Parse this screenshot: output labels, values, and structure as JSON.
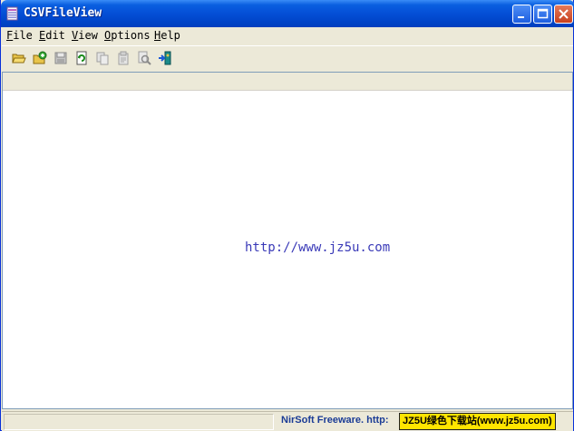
{
  "window": {
    "title": "CSVFileView"
  },
  "menu": {
    "items": [
      {
        "label": "File",
        "underline": "F"
      },
      {
        "label": "Edit",
        "underline": "E"
      },
      {
        "label": "View",
        "underline": "V"
      },
      {
        "label": "Options",
        "underline": "O"
      },
      {
        "label": "Help",
        "underline": "H"
      }
    ]
  },
  "toolbar": {
    "buttons": [
      {
        "icon": "open-folder-icon"
      },
      {
        "icon": "open-refresh-icon"
      },
      {
        "icon": "save-icon"
      },
      {
        "icon": "refresh-icon"
      },
      {
        "icon": "copy-icon"
      },
      {
        "icon": "properties-icon"
      },
      {
        "icon": "find-icon"
      },
      {
        "icon": "exit-icon"
      }
    ]
  },
  "content": {
    "watermark": "http://www.jz5u.com"
  },
  "status": {
    "freeware": "NirSoft Freeware.  http:",
    "badge": "JZ5U绿色下载站(www.jz5u.com)"
  },
  "colors": {
    "titlebar": "#0551d8",
    "watermark": "#3a3ab8",
    "badge_bg": "#ffe500",
    "status_text": "#1b3c96"
  }
}
